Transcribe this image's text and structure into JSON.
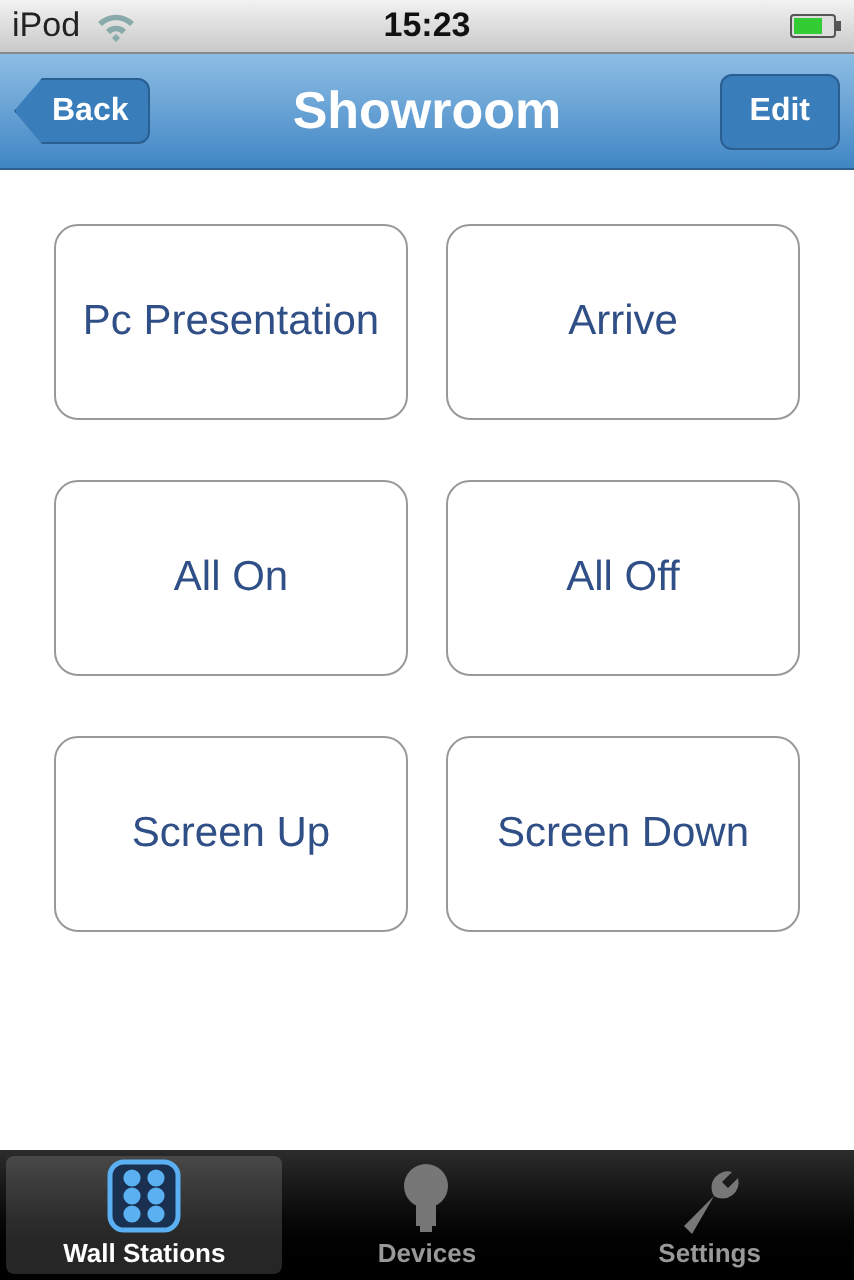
{
  "status_bar": {
    "carrier": "iPod",
    "time": "15:23"
  },
  "nav_bar": {
    "back": "Back",
    "title": "Showroom",
    "edit": "Edit"
  },
  "scenes": [
    "Pc Presentation",
    "Arrive",
    "All On",
    "All Off",
    "Screen Up",
    "Screen Down"
  ],
  "tabs": [
    {
      "label": "Wall Stations",
      "kind": "grid",
      "selected": true
    },
    {
      "label": "Devices",
      "kind": "bulb",
      "selected": false
    },
    {
      "label": "Settings",
      "kind": "wrench",
      "selected": false
    }
  ]
}
